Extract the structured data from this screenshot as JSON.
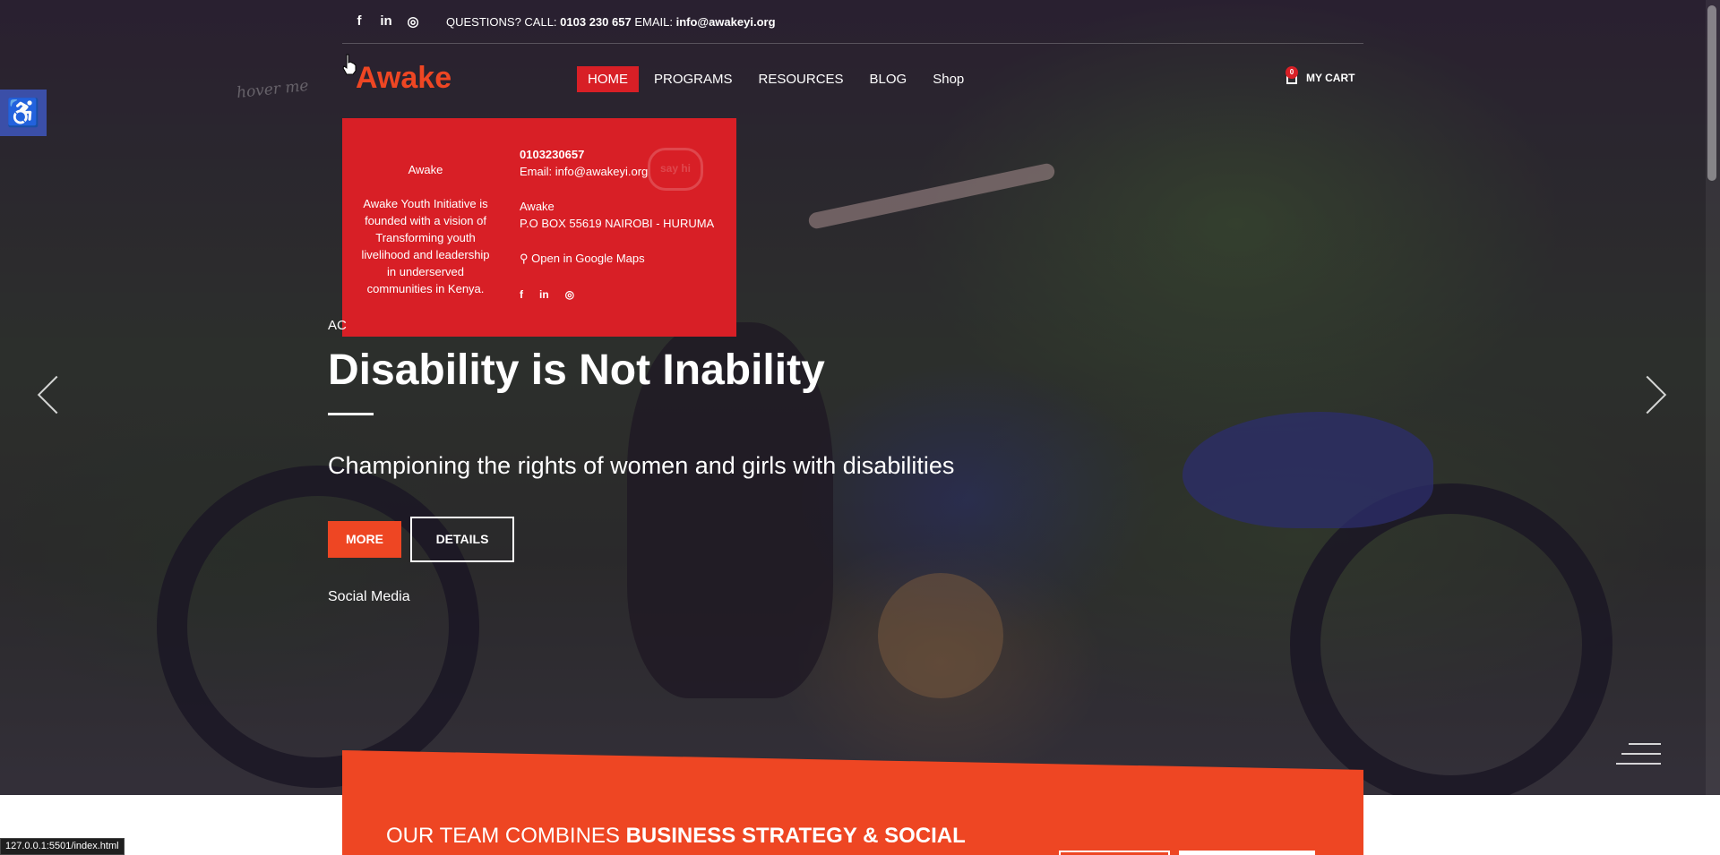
{
  "header": {
    "social": [
      {
        "icon": "facebook-icon",
        "glyph": "f"
      },
      {
        "icon": "linkedin-icon",
        "glyph": "in"
      },
      {
        "icon": "instagram-icon",
        "glyph": "◎"
      }
    ],
    "questions_label": "QUESTIONS? CALL:",
    "phone": "0103 230 657",
    "email_label": "EMAIL:",
    "email": "info@awakeyi.org"
  },
  "brand": {
    "logo": "Awake",
    "hover_hint": "hover me",
    "accent": "#ee4623"
  },
  "nav": {
    "items": [
      {
        "label": "HOME",
        "active": true
      },
      {
        "label": "PROGRAMS",
        "active": false
      },
      {
        "label": "RESOURCES",
        "active": false
      },
      {
        "label": "BLOG",
        "active": false
      },
      {
        "label": "Shop",
        "active": false
      }
    ],
    "cart_label": "MY CART",
    "cart_count": "0"
  },
  "dropdown": {
    "logo_alt": "Awake",
    "about": "Awake Youth Initiative is founded with a vision of Transforming youth livelihood and leadership in underserved communities in Kenya.",
    "phone": "0103230657",
    "email": "Email: info@awakeyi.org",
    "org_name": "Awake",
    "address": "P.O BOX 55619 NAIROBI - HURUMA",
    "maps_link": "Open in Google Maps",
    "say_hi": "say hi",
    "bg_color": "#d81f26"
  },
  "hero": {
    "pre_label": "AC",
    "title": "Disability is Not Inability",
    "subtitle": "Championing the rights of women and girls with disabilities",
    "more_button": "MORE",
    "details_button": "DETAILS",
    "social_media": "Social Media"
  },
  "band": {
    "text_plain": "OUR TEAM COMBINES ",
    "text_bold": "BUSINESS STRATEGY & SOCIAL"
  },
  "status": {
    "url": "127.0.0.1:5501/index.html"
  }
}
